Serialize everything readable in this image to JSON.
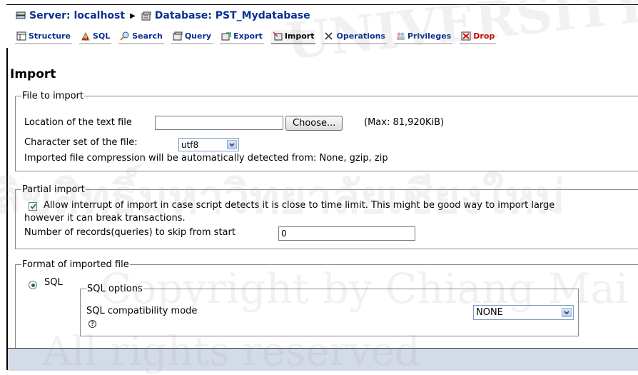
{
  "breadcrumb": {
    "server": "Server: localhost",
    "database": "Database: PST_Mydatabase"
  },
  "tabs": [
    {
      "label": "Structure",
      "icon": "structure-icon"
    },
    {
      "label": "SQL",
      "icon": "sql-icon"
    },
    {
      "label": "Search",
      "icon": "search-icon"
    },
    {
      "label": "Query",
      "icon": "query-icon"
    },
    {
      "label": "Export",
      "icon": "export-icon"
    },
    {
      "label": "Import",
      "icon": "import-icon"
    },
    {
      "label": "Operations",
      "icon": "operations-icon"
    },
    {
      "label": "Privileges",
      "icon": "privileges-icon"
    },
    {
      "label": "Drop",
      "icon": "drop-icon"
    }
  ],
  "page": {
    "title": "Import"
  },
  "file_section": {
    "legend": "File to import",
    "location_label": "Location of the text file",
    "location_value": "",
    "choose_label": "Choose...",
    "max_label": "(Max: 81,920KiB)",
    "charset_label": "Character set of the file:",
    "charset_value": "utf8",
    "compression_text": "Imported file compression will be automatically detected from: None, gzip, zip"
  },
  "partial_section": {
    "legend": "Partial import",
    "allow_interrupt_checked": true,
    "allow_interrupt_text": "Allow interrupt of import in case script detects it is close to time limit. This might be good way to import large",
    "allow_interrupt_text2": "however it can break transactions.",
    "skip_label": "Number of records(queries) to skip from start",
    "skip_value": "0"
  },
  "format_section": {
    "legend": "Format of imported file",
    "sql_label": "SQL",
    "sql_selected": true,
    "options_legend": "SQL options",
    "compat_label": "SQL compatibility mode",
    "compat_value": "NONE"
  },
  "watermark": {
    "line1": "UNIVERSITY",
    "line2": "ลิขสิทธิ์มหาวิทยาลัยเชียงใหม่",
    "line3": "Copyright by Chiang Mai University",
    "line4": "All rights reserved"
  },
  "colors": {
    "link": "#0a2f8f",
    "drop": "#cc0000",
    "footer": "#d4dbe8"
  }
}
